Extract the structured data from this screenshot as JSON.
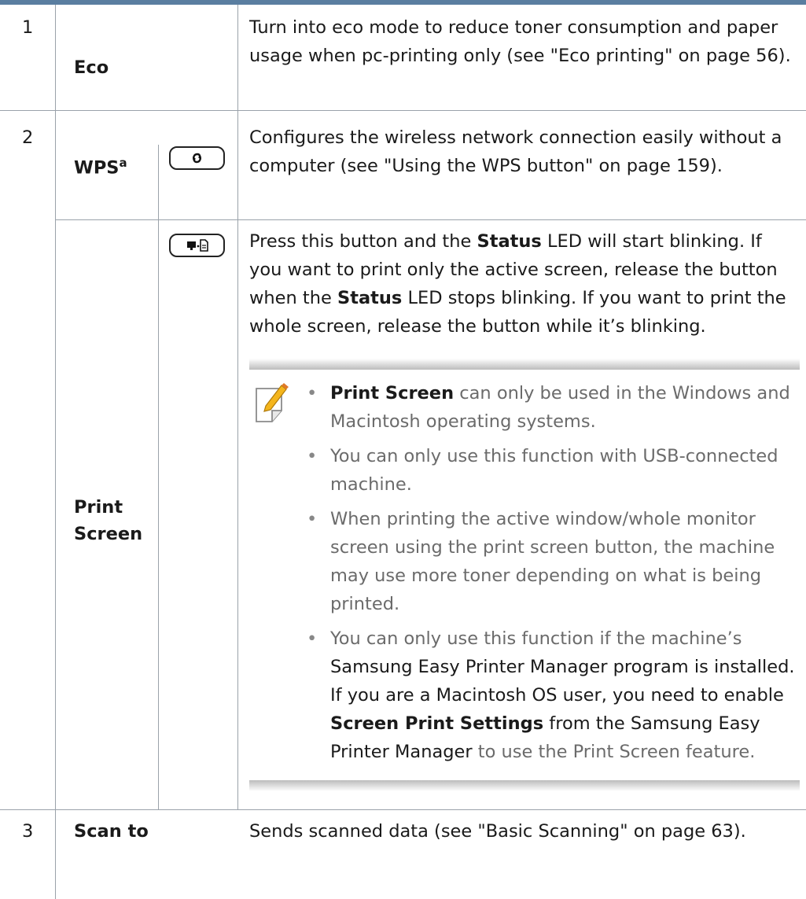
{
  "rows": [
    {
      "num": "1",
      "name": "Eco",
      "description": "Turn into eco mode to reduce toner consumption and paper usage when pc-printing only (see \"Eco printing\" on page 56)."
    },
    {
      "num": "2",
      "name": "WPS",
      "name_sup": "a",
      "icon": "wps-icon",
      "description": "Configures the wireless network connection easily without a computer (see \"Using the WPS button\" on page 159)."
    },
    {
      "num": "",
      "name_line1": "Print",
      "name_line2": "Screen",
      "icon": "print-screen-icon",
      "description": {
        "t1": "Press this button and the ",
        "b1": "Status",
        "t2": " LED will start blinking. If you want to print only the active screen, release the button when the ",
        "b2": "Status",
        "t3": " LED stops blinking. If you want to print the whole screen, release the button while it’s blinking."
      },
      "note": {
        "icon": "note-pencil-icon",
        "bullets": [
          {
            "bold": "Print Screen",
            "text": " can only be used in the Windows and Macintosh operating systems."
          },
          {
            "text": "You can only use this function with USB-connected machine."
          },
          {
            "text": "When printing the active window/whole monitor screen using the print screen button, the machine may use more toner depending on what is being printed."
          },
          {
            "t1": "You can only use this function if the machine’s ",
            "d1": "Samsung Easy Printer Manager program is installed. If you are a Macintosh OS user, you need to enable ",
            "b1": "Screen Print Settings",
            "d2": " from the Samsung Easy Printer Manager",
            "t2": " to use the Print Screen feature."
          }
        ]
      }
    },
    {
      "num": "3",
      "name": "Scan to",
      "description": "Sends scanned data (see \"Basic Scanning\" on page 63)."
    }
  ]
}
